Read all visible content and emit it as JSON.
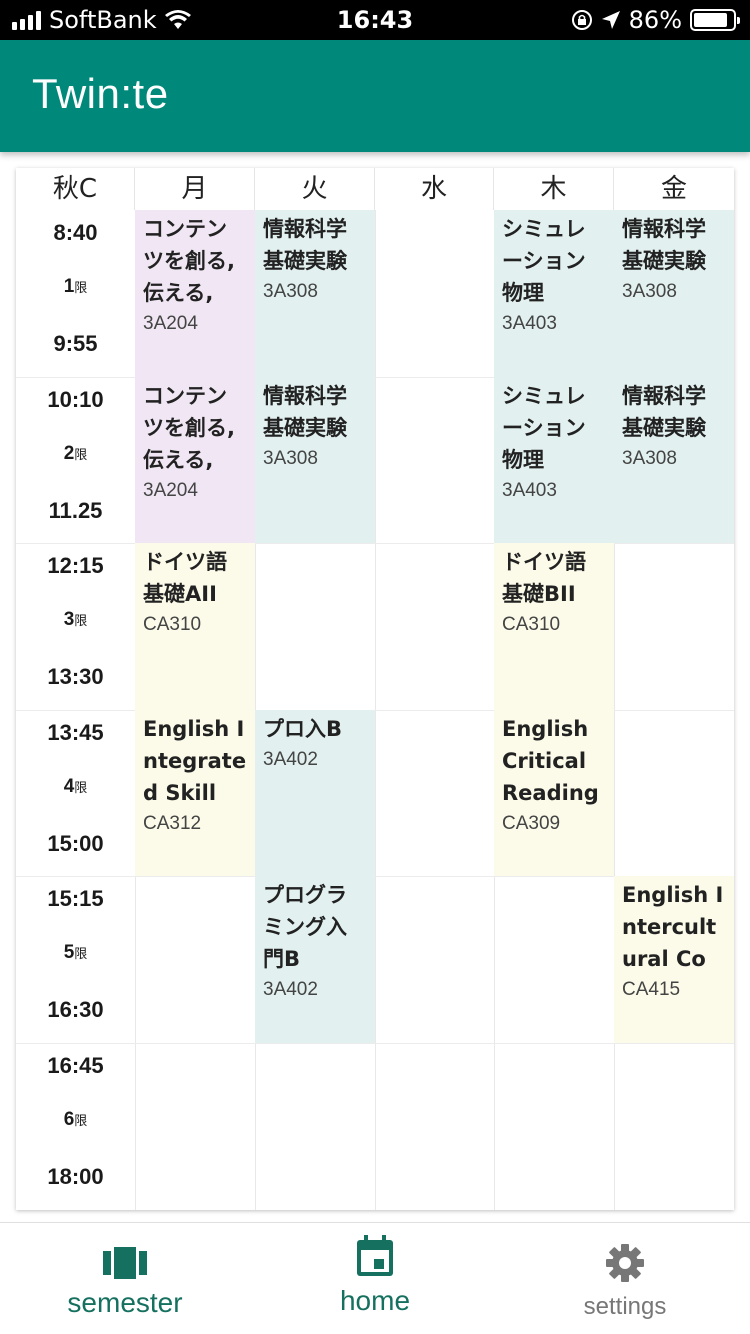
{
  "status": {
    "carrier": "SoftBank",
    "time": "16:43",
    "battery": "86%"
  },
  "app": {
    "title": "Twin:te"
  },
  "timetable": {
    "term": "秋C",
    "days": [
      "月",
      "火",
      "水",
      "木",
      "金"
    ],
    "periods": [
      {
        "start": "8:40",
        "label": "1",
        "unit": "限",
        "end": "9:55"
      },
      {
        "start": "10:10",
        "label": "2",
        "unit": "限",
        "end": "11.25"
      },
      {
        "start": "12:15",
        "label": "3",
        "unit": "限",
        "end": "13:30"
      },
      {
        "start": "13:45",
        "label": "4",
        "unit": "限",
        "end": "15:00"
      },
      {
        "start": "15:15",
        "label": "5",
        "unit": "限",
        "end": "16:30"
      },
      {
        "start": "16:45",
        "label": "6",
        "unit": "限",
        "end": "18:00"
      }
    ],
    "cells": [
      [
        {
          "name": "コンテンツを創る,伝える,",
          "room": "3A204",
          "color": "#f1e7f4"
        },
        {
          "name": "情報科学基礎実験",
          "room": "3A308",
          "color": "#e2f1f0"
        },
        null,
        {
          "name": "シミュレーション物理",
          "room": "3A403",
          "color": "#e2f1f0"
        },
        {
          "name": "情報科学基礎実験",
          "room": "3A308",
          "color": "#e2f1f0"
        }
      ],
      [
        {
          "name": "コンテンツを創る,伝える,",
          "room": "3A204",
          "color": "#f1e7f4"
        },
        {
          "name": "情報科学基礎実験",
          "room": "3A308",
          "color": "#e2f1f0"
        },
        null,
        {
          "name": "シミュレーション物理",
          "room": "3A403",
          "color": "#e2f1f0"
        },
        {
          "name": "情報科学基礎実験",
          "room": "3A308",
          "color": "#e2f1f0"
        }
      ],
      [
        {
          "name": "ドイツ語基礎AII",
          "room": "CA310",
          "color": "#fcfbe9"
        },
        null,
        null,
        {
          "name": "ドイツ語基礎BII",
          "room": "CA310",
          "color": "#fcfbe9"
        },
        null
      ],
      [
        {
          "name": "English Integrated Skill",
          "room": "CA312",
          "color": "#fcfbe9"
        },
        {
          "name": "プロ入B",
          "room": "3A402",
          "color": "#e2f1f0"
        },
        null,
        {
          "name": "English Critical Reading",
          "room": "CA309",
          "color": "#fcfbe9"
        },
        null
      ],
      [
        null,
        {
          "name": "プログラミング入門B",
          "room": "3A402",
          "color": "#e2f1f0"
        },
        null,
        null,
        {
          "name": "English Intercultural Co",
          "room": "CA415",
          "color": "#fcfbe9"
        }
      ],
      [
        null,
        null,
        null,
        null,
        null
      ]
    ]
  },
  "nav": [
    {
      "key": "semester",
      "label": "semester",
      "icon": "view-carousel-icon",
      "color": "#16705f"
    },
    {
      "key": "home",
      "label": "home",
      "icon": "calendar-today-icon",
      "color": "#16705f"
    },
    {
      "key": "settings",
      "label": "settings",
      "icon": "gear-icon",
      "color": "#777777"
    }
  ]
}
